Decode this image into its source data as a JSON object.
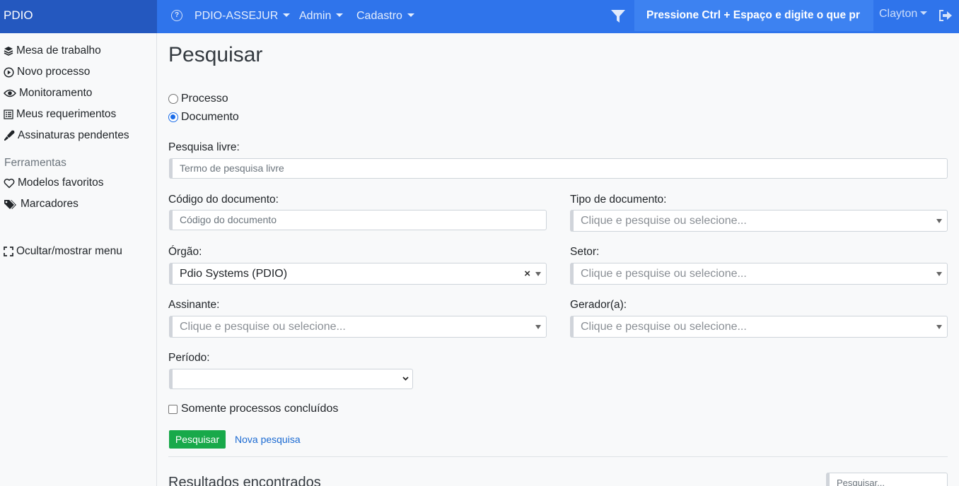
{
  "navbar": {
    "brand": "PDIO",
    "menus": [
      "PDIO-ASSEJUR",
      "Admin",
      "Cadastro"
    ],
    "command_hint": "Pressione Ctrl + Espaço e digite o que pr",
    "user": "Clayton"
  },
  "sidebar": {
    "items": [
      {
        "label": "Mesa de trabalho",
        "icon": "layers-icon"
      },
      {
        "label": "Novo processo",
        "icon": "play-circle-icon"
      },
      {
        "label": "Monitoramento",
        "icon": "eye-icon"
      },
      {
        "label": "Meus requerimentos",
        "icon": "list-alt-icon"
      },
      {
        "label": "Assinaturas pendentes",
        "icon": "pen-icon"
      }
    ],
    "tools_heading": "Ferramentas",
    "tools": [
      {
        "label": "Modelos favoritos",
        "icon": "heart-icon"
      },
      {
        "label": "Marcadores",
        "icon": "tags-icon"
      }
    ],
    "toggle_menu": {
      "label": "Ocultar/mostrar menu",
      "icon": "expand-icon"
    }
  },
  "search": {
    "title": "Pesquisar",
    "type_options": [
      {
        "label": "Processo",
        "selected": false
      },
      {
        "label": "Documento",
        "selected": true
      }
    ],
    "free_text": {
      "label": "Pesquisa livre:",
      "placeholder": "Termo de pesquisa livre"
    },
    "doc_code": {
      "label": "Código do documento:",
      "placeholder": "Código do documento"
    },
    "doc_type": {
      "label": "Tipo de documento:",
      "placeholder": "Clique e pesquise ou selecione..."
    },
    "organ": {
      "label": "Órgão:",
      "value": "Pdio Systems (PDIO)"
    },
    "sector": {
      "label": "Setor:",
      "placeholder": "Clique e pesquise ou selecione..."
    },
    "signer": {
      "label": "Assinante:",
      "placeholder": "Clique e pesquise ou selecione..."
    },
    "generator": {
      "label": "Gerador(a):",
      "placeholder": "Clique e pesquise ou selecione..."
    },
    "period": {
      "label": "Período:",
      "value": ""
    },
    "only_completed": {
      "label": "Somente processos concluídos",
      "checked": false
    },
    "search_button": "Pesquisar",
    "new_search_link": "Nova pesquisa"
  },
  "results": {
    "title": "Resultados encontrados",
    "search_placeholder": "Pesquisar..."
  },
  "colors": {
    "navbar": "#2f74eb",
    "brand_bg": "#2458bf",
    "primary_button": "#18a94a",
    "link": "#1b6ad2"
  }
}
